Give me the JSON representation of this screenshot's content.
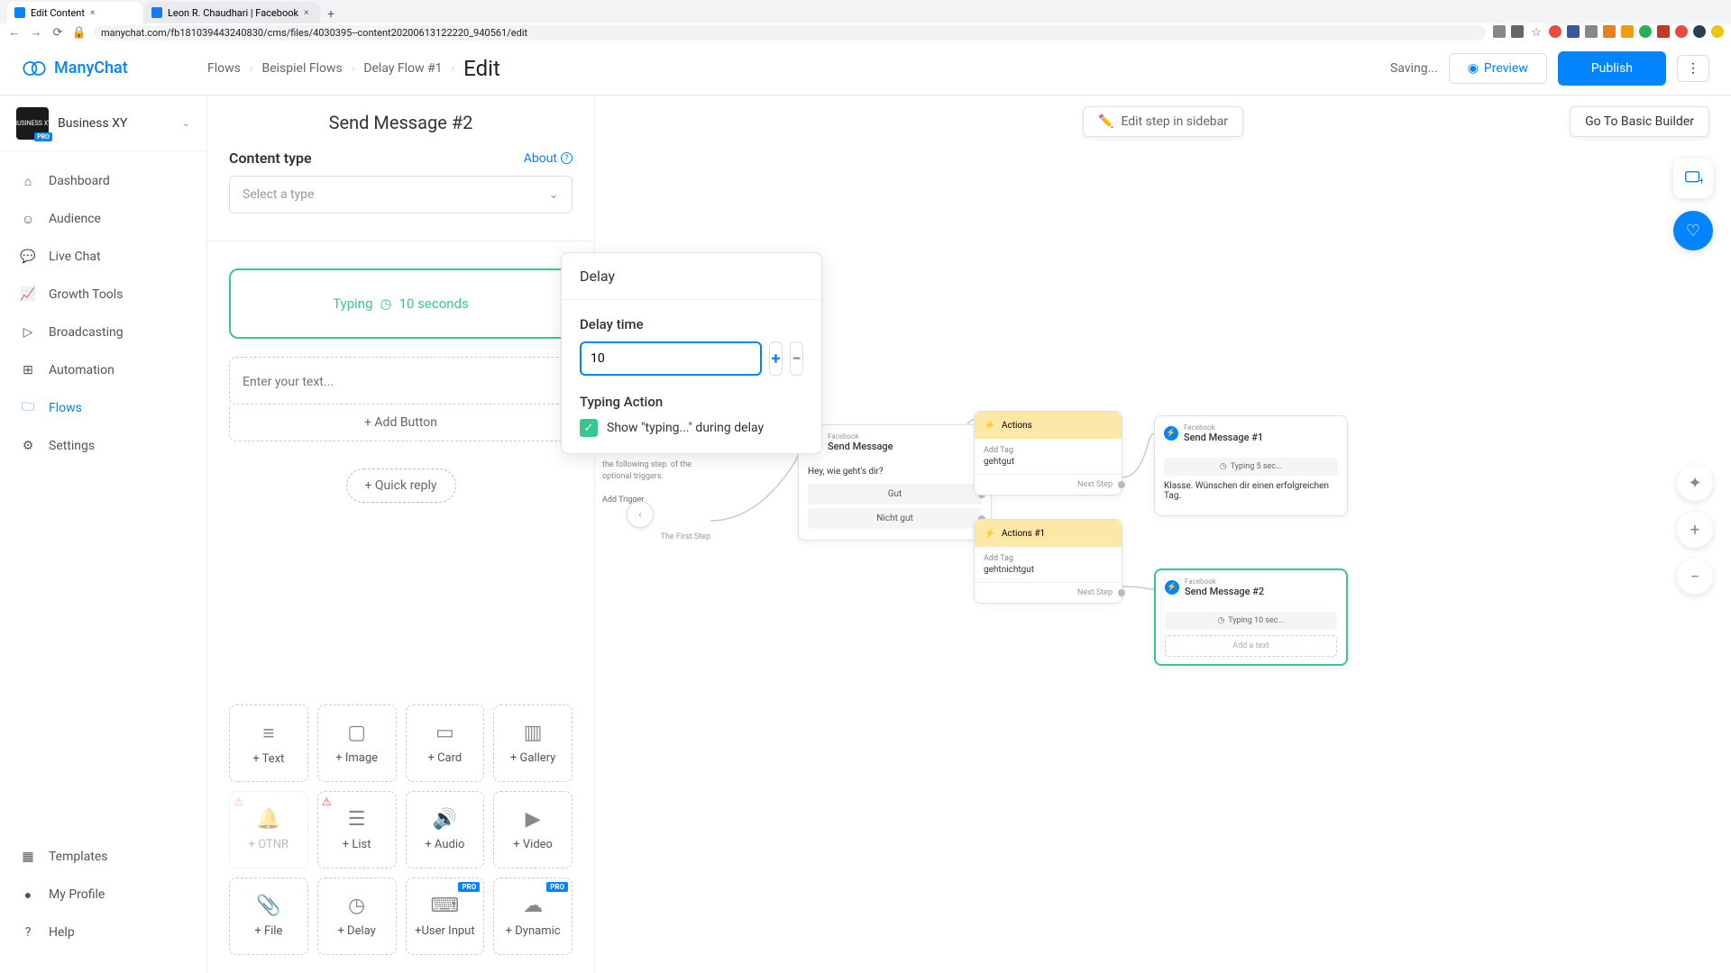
{
  "browser": {
    "tabs": [
      {
        "title": "Edit Content",
        "favicon": "#0084ff"
      },
      {
        "title": "Leon R. Chaudhari | Facebook",
        "favicon": "#1877f2"
      }
    ],
    "url": "manychat.com/fb181039443240830/cms/files/4030395--content20200613122220_940561/edit"
  },
  "header": {
    "logo": "ManyChat",
    "breadcrumb": [
      "Flows",
      "Beispiel Flows",
      "Delay Flow #1"
    ],
    "current": "Edit",
    "saving": "Saving...",
    "preview": "Preview",
    "publish": "Publish"
  },
  "workspace": {
    "name": "Business XY",
    "badge": "PRO"
  },
  "nav": {
    "items": [
      {
        "label": "Dashboard",
        "icon": "⌂"
      },
      {
        "label": "Audience",
        "icon": "☺"
      },
      {
        "label": "Live Chat",
        "icon": "💬"
      },
      {
        "label": "Growth Tools",
        "icon": "📈"
      },
      {
        "label": "Broadcasting",
        "icon": "▷"
      },
      {
        "label": "Automation",
        "icon": "⊞"
      },
      {
        "label": "Flows",
        "icon": "🗀",
        "active": true
      },
      {
        "label": "Settings",
        "icon": "⚙"
      }
    ],
    "bottom": [
      {
        "label": "Templates",
        "icon": "▦"
      },
      {
        "label": "My Profile",
        "icon": "●"
      },
      {
        "label": "Help",
        "icon": "?"
      }
    ]
  },
  "editor": {
    "title": "Send Message #2",
    "contentTypeLabel": "Content type",
    "about": "About",
    "selectPlaceholder": "Select a type",
    "typingLabel": "Typing",
    "typingDuration": "10 seconds",
    "textPlaceholder": "Enter your text...",
    "addButton": "+ Add Button",
    "quickReply": "+ Quick reply",
    "blocks": [
      {
        "label": "+ Text"
      },
      {
        "label": "+ Image"
      },
      {
        "label": "+ Card"
      },
      {
        "label": "+ Gallery"
      },
      {
        "label": "+ OTNR",
        "disabled": true,
        "warn": true
      },
      {
        "label": "+ List",
        "warn": true
      },
      {
        "label": "+ Audio"
      },
      {
        "label": "+ Video"
      },
      {
        "label": "+ File"
      },
      {
        "label": "+ Delay"
      },
      {
        "label": "+User Input",
        "pro": true
      },
      {
        "label": "+ Dynamic",
        "pro": true
      }
    ]
  },
  "popover": {
    "title": "Delay",
    "delayTimeLabel": "Delay time",
    "value": "10",
    "typingActionLabel": "Typing Action",
    "checkboxLabel": "Show \"typing...\" during delay"
  },
  "canvas": {
    "editStep": "Edit step in sidebar",
    "gotoBasic": "Go To Basic Builder",
    "triggerText": "the following step. of the optional triggers.",
    "addTrigger": "Add Trigger",
    "firstStep": "The First Step",
    "nodes": {
      "sendMsg": {
        "platform": "Facebook",
        "title": "Send Message",
        "text": "Hey, wie geht's dir?",
        "btn1": "Gut",
        "btn2": "Nicht gut"
      },
      "actions": {
        "title": "Actions",
        "tagLabel": "Add Tag",
        "tagVal": "gehtgut",
        "next": "Next Step"
      },
      "actions1": {
        "title": "Actions #1",
        "tagLabel": "Add Tag",
        "tagVal": "gehtnichtgut",
        "next": "Next Step"
      },
      "sendMsg1": {
        "platform": "Facebook",
        "title": "Send Message #1",
        "typing": "Typing 5 sec...",
        "text": "Klasse. Wünschen dir einen erfolgreichen Tag."
      },
      "sendMsg2": {
        "platform": "Facebook",
        "title": "Send Message #2",
        "typing": "Typing 10 sec...",
        "addText": "Add a text"
      }
    }
  }
}
